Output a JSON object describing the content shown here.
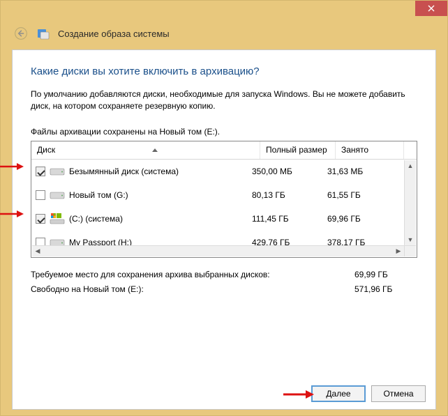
{
  "window": {
    "title": "Создание образа системы"
  },
  "heading": "Какие диски вы хотите включить в архивацию?",
  "description": "По умолчанию добавляются диски, необходимые для запуска Windows. Вы не можете добавить диск, на котором сохраняете резервную копию.",
  "saved_to": "Файлы архивации сохранены на Новый том (E:).",
  "columns": {
    "disk": "Диск",
    "full_size": "Полный размер",
    "used": "Занято"
  },
  "disks": [
    {
      "checked": true,
      "system_os": false,
      "name": "Безымянный диск (система)",
      "size": "350,00 МБ",
      "used": "31,63 МБ"
    },
    {
      "checked": false,
      "system_os": false,
      "name": "Новый том (G:)",
      "size": "80,13 ГБ",
      "used": "61,55 ГБ"
    },
    {
      "checked": true,
      "system_os": true,
      "name": "(C:) (система)",
      "size": "111,45 ГБ",
      "used": "69,96 ГБ"
    },
    {
      "checked": false,
      "system_os": false,
      "name": "My Passport (H:)",
      "size": "429,76 ГБ",
      "used": "378,17 ГБ"
    }
  ],
  "summary": {
    "required_label": "Требуемое место для сохранения архива выбранных дисков:",
    "required_value": "69,99 ГБ",
    "free_label": "Свободно на Новый том (E:):",
    "free_value": "571,96 ГБ"
  },
  "buttons": {
    "next": "Далее",
    "cancel": "Отмена"
  }
}
